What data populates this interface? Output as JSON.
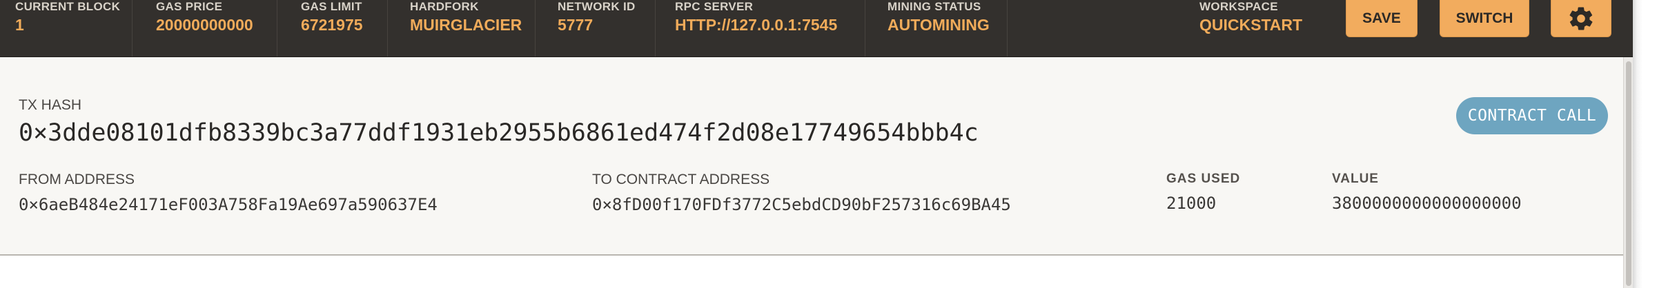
{
  "header": {
    "stats": [
      {
        "label": "CURRENT BLOCK",
        "value": "1"
      },
      {
        "label": "GAS PRICE",
        "value": "20000000000"
      },
      {
        "label": "GAS LIMIT",
        "value": "6721975"
      },
      {
        "label": "HARDFORK",
        "value": "MUIRGLACIER"
      },
      {
        "label": "NETWORK ID",
        "value": "5777"
      },
      {
        "label": "RPC SERVER",
        "value": "HTTP://127.0.0.1:7545"
      },
      {
        "label": "MINING STATUS",
        "value": "AUTOMINING"
      }
    ],
    "workspace": {
      "label": "WORKSPACE",
      "value": "QUICKSTART"
    },
    "save_label": "SAVE",
    "switch_label": "SWITCH",
    "settings_icon": "gear-icon",
    "colors": {
      "bar": "#33302d",
      "accent": "#f0ab5a",
      "button": "#f2ac5e"
    }
  },
  "transaction": {
    "hash_label": "TX HASH",
    "hash": "0×3dde08101dfb8339bc3a77ddf1931eb2955b6861ed474f2d08e17749654bbb4c",
    "type_badge": "CONTRACT CALL",
    "from_label": "FROM ADDRESS",
    "from": "0×6aeB484e24171eF003A758Fa19Ae697a590637E4",
    "to_label": "TO CONTRACT ADDRESS",
    "to": "0×8fD00f170FDf3772C5ebdCD90bF257316c69BA45",
    "gas_used_label": "GAS USED",
    "gas_used": "21000",
    "value_label": "VALUE",
    "value": "3800000000000000000",
    "colors": {
      "badge": "#6ea5c0"
    }
  }
}
